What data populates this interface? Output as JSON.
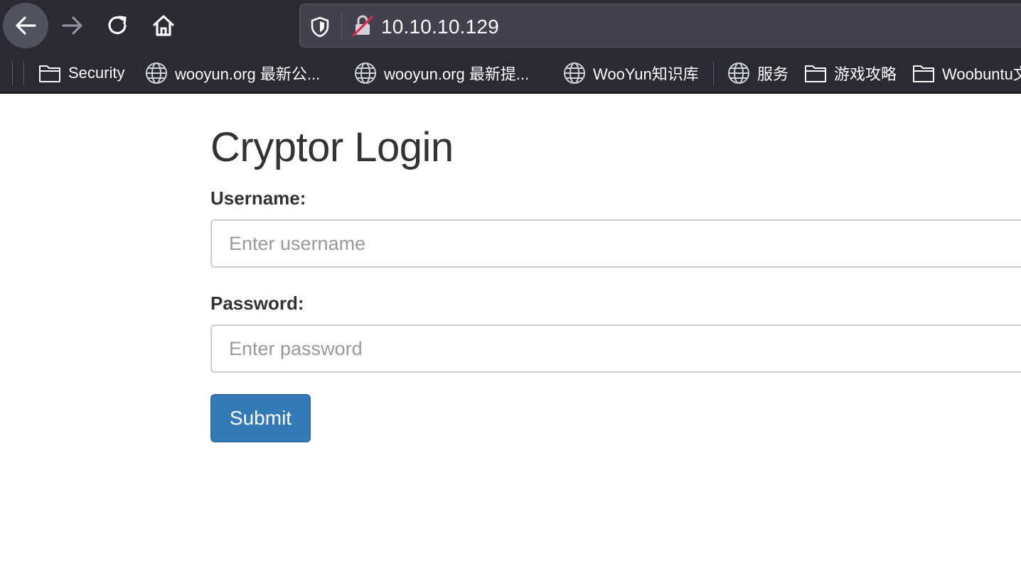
{
  "browser": {
    "url": "10.10.10.129",
    "bookmarks": [
      {
        "label": "Security",
        "icon": "folder-icon"
      },
      {
        "label": "wooyun.org 最新公...",
        "icon": "globe-icon"
      },
      {
        "label": "wooyun.org 最新提...",
        "icon": "globe-icon"
      },
      {
        "label": "WooYun知识库",
        "icon": "globe-icon"
      },
      {
        "label": "服务",
        "icon": "globe-icon"
      },
      {
        "label": "游戏攻略",
        "icon": "folder-icon"
      },
      {
        "label": "Woobuntu文",
        "icon": "folder-icon"
      }
    ]
  },
  "login": {
    "title": "Cryptor Login",
    "username_label": "Username:",
    "username_placeholder": "Enter username",
    "username_value": "",
    "password_label": "Password:",
    "password_placeholder": "Enter password",
    "password_value": "",
    "submit_label": "Submit"
  },
  "colors": {
    "chrome_bg": "#2b2a33",
    "urlbar_bg": "#42414d",
    "heading_text": "#333333",
    "button_primary": "#337ab7",
    "insecure_slash": "#e22850"
  }
}
